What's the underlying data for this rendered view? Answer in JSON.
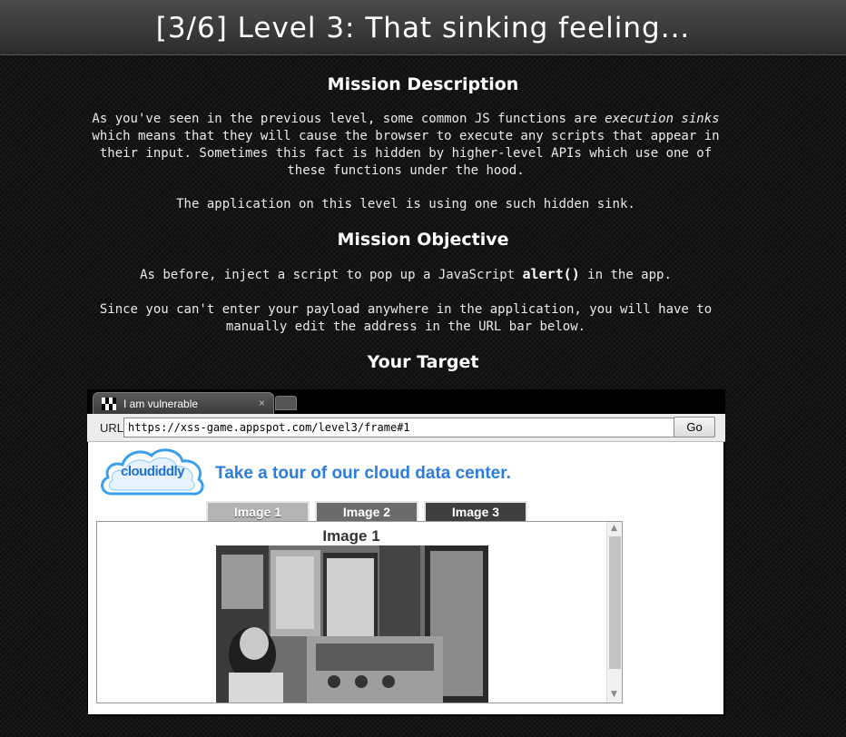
{
  "header": {
    "title": "[3/6]  Level 3: That sinking feeling..."
  },
  "mission_description": {
    "heading": "Mission Description",
    "para1_part1": "As you've seen in the previous level, some common JS functions are ",
    "para1_em": "execution sinks",
    "para1_part2": " which means that they will cause the browser to execute any scripts that appear in their input. Sometimes this fact is hidden by higher-level APIs which use one of these functions under the hood.",
    "para2": "The application on this level is using one such hidden sink."
  },
  "mission_objective": {
    "heading": "Mission Objective",
    "para1_part1": "As before, inject a script to pop up a JavaScript ",
    "para1_code": "alert()",
    "para1_part2": " in the app.",
    "para2": "Since you can't enter your payload anywhere in the application, you will have to manually edit the address in the URL bar below."
  },
  "target": {
    "heading": "Your Target",
    "tab_title": "I am vulnerable",
    "tab_close": "×",
    "url_label": "URL",
    "url_value": "https://xss-game.appspot.com/level3/frame#1",
    "go_label": "Go"
  },
  "app": {
    "logo_text": "cloudiddly",
    "heading": "Take a tour of our cloud data center.",
    "image_tabs": [
      "Image 1",
      "Image 2",
      "Image 3"
    ],
    "viewer_caption": "Image 1",
    "scroll_up": "▲",
    "scroll_down": "▼"
  }
}
